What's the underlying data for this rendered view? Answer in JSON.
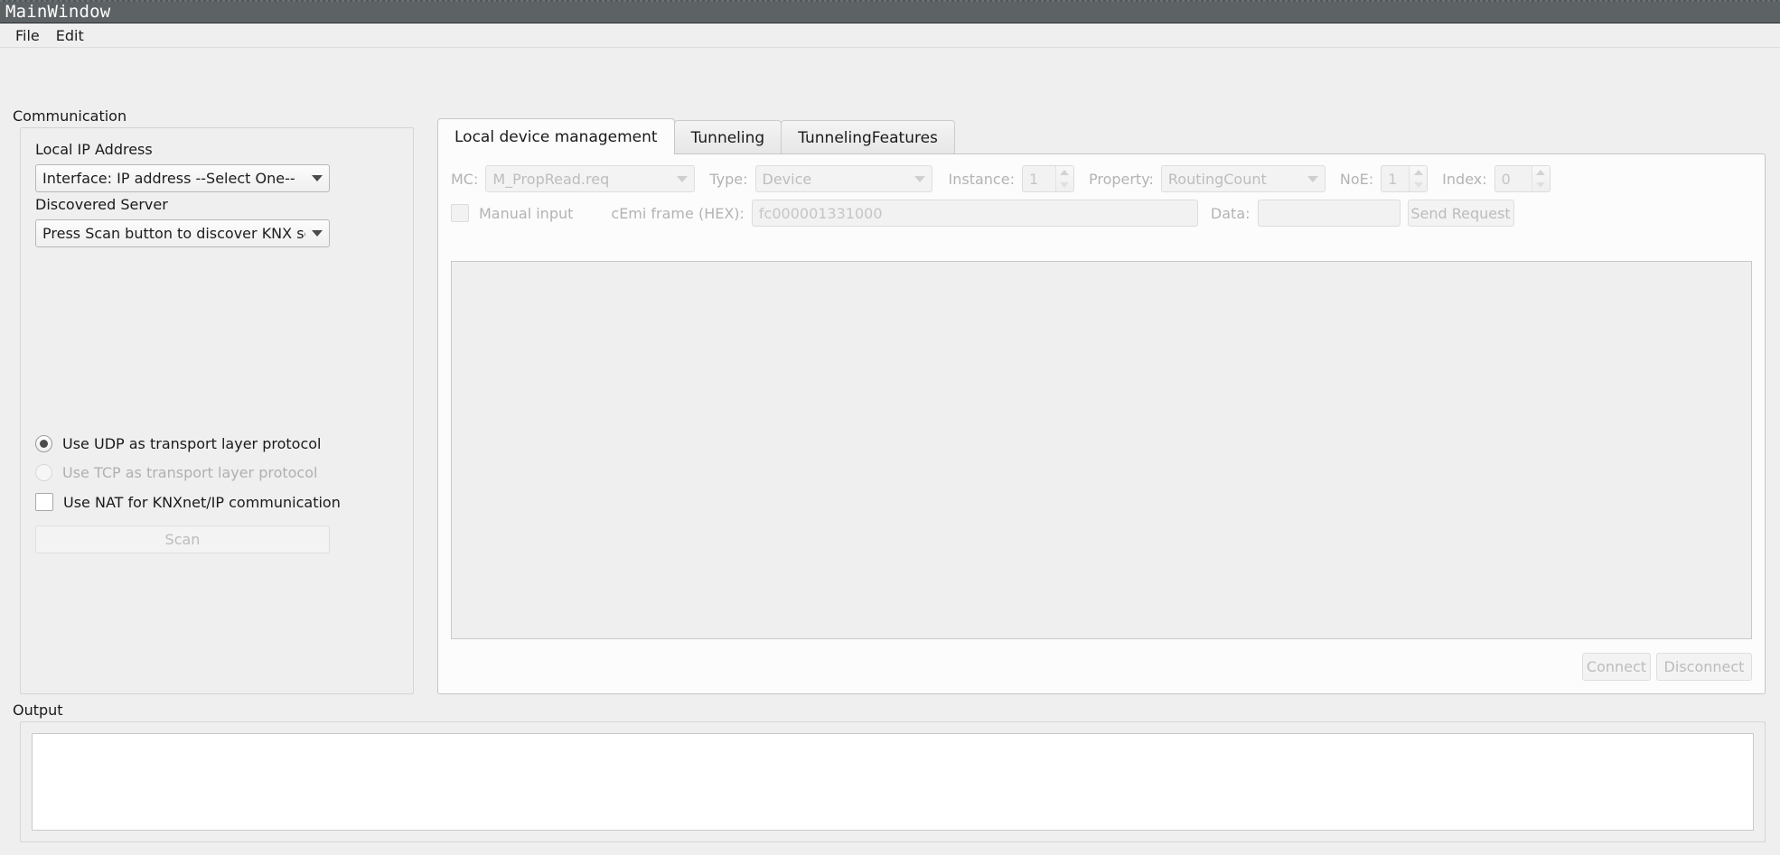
{
  "window": {
    "title": "MainWindow"
  },
  "menu": {
    "items": [
      "File",
      "Edit"
    ]
  },
  "communication": {
    "group_title": "Communication",
    "local_ip_label": "Local IP Address",
    "interface_combo_value": "Interface: IP address --Select One--",
    "discovered_server_label": "Discovered Server",
    "discovered_server_combo_value": "Press Scan button to discover KNX servers",
    "udp_radio_label": "Use UDP as transport layer protocol",
    "tcp_radio_label": "Use TCP as transport layer protocol",
    "nat_checkbox_label": "Use NAT for KNXnet/IP communication",
    "scan_button_label": "Scan"
  },
  "tabs": {
    "items": [
      {
        "label": "Local device management",
        "active": true
      },
      {
        "label": "Tunneling",
        "active": false
      },
      {
        "label": "TunnelingFeatures",
        "active": false
      }
    ]
  },
  "device_management": {
    "mc_label": "MC:",
    "mc_value": "M_PropRead.req",
    "type_label": "Type:",
    "type_value": "Device",
    "instance_label": "Instance:",
    "instance_value": "1",
    "property_label": "Property:",
    "property_value": "RoutingCount",
    "noe_label": "NoE:",
    "noe_value": "1",
    "index_label": "Index:",
    "index_value": "0",
    "manual_input_label": "Manual input",
    "cemi_label": "cEmi frame (HEX):",
    "cemi_value": "fc000001331000",
    "data_label": "Data:",
    "data_value": "",
    "send_request_label": "Send Request",
    "connect_label": "Connect",
    "disconnect_label": "Disconnect"
  },
  "output": {
    "group_title": "Output",
    "text": ""
  },
  "colors": {
    "titlebar_bg": "#5d6265",
    "window_bg": "#efefef",
    "panel_bg": "#fcfcfc",
    "disabled_text": "#bdbdbd",
    "text": "#1a1a1a"
  }
}
